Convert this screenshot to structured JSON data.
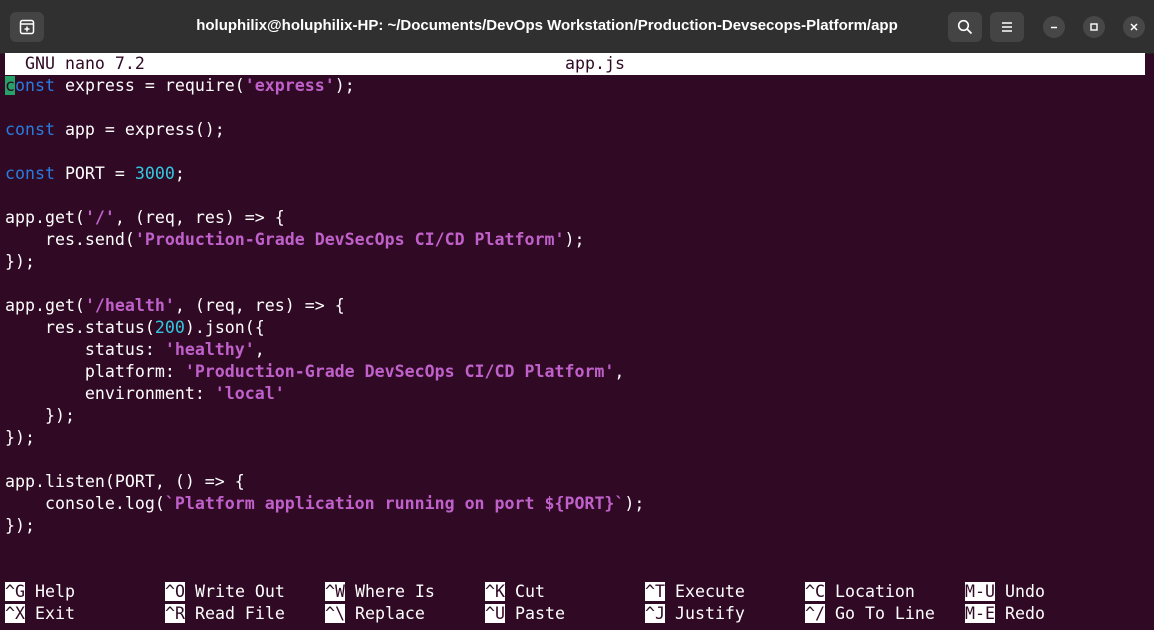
{
  "window": {
    "title": "holuphilix@holuphilix-HP: ~/Documents/DevOps Workstation/Production-Devsecops-Platform/app"
  },
  "nano": {
    "version": "GNU nano 7.2",
    "filename": "app.js"
  },
  "code": {
    "l1_kw": "const",
    "l1_rest_a": " express = require(",
    "l1_str": "'express'",
    "l1_rest_b": ");",
    "l3_kw": "const",
    "l3_rest": " app = express();",
    "l5_kw": "const",
    "l5_rest_a": " PORT = ",
    "l5_num": "3000",
    "l5_rest_b": ";",
    "l7_a": "app.get(",
    "l7_str": "'/'",
    "l7_b": ", (req, res) => {",
    "l8_a": "    res.send(",
    "l8_str": "'Production-Grade DevSecOps CI/CD Platform'",
    "l8_b": ");",
    "l9": "});",
    "l11_a": "app.get(",
    "l11_str": "'/health'",
    "l11_b": ", (req, res) => {",
    "l12_a": "    res.status(",
    "l12_num": "200",
    "l12_b": ").json({",
    "l13_a": "        status: ",
    "l13_str": "'healthy'",
    "l13_b": ",",
    "l14_a": "        platform: ",
    "l14_str": "'Production-Grade DevSecOps CI/CD Platform'",
    "l14_b": ",",
    "l15_a": "        environment: ",
    "l15_str": "'local'",
    "l16": "    });",
    "l17": "});",
    "l19": "app.listen(PORT, () => {",
    "l20_a": "    console.log(",
    "l20_str": "`Platform application running on port ${PORT}`",
    "l20_b": ");",
    "l21": "});"
  },
  "shortcuts": [
    {
      "key": "^G",
      "label": "Help"
    },
    {
      "key": "^O",
      "label": "Write Out"
    },
    {
      "key": "^W",
      "label": "Where Is"
    },
    {
      "key": "^K",
      "label": "Cut"
    },
    {
      "key": "^T",
      "label": "Execute"
    },
    {
      "key": "^C",
      "label": "Location"
    },
    {
      "key": "M-U",
      "label": "Undo"
    },
    {
      "key": "^X",
      "label": "Exit"
    },
    {
      "key": "^R",
      "label": "Read File"
    },
    {
      "key": "^\\",
      "label": "Replace"
    },
    {
      "key": "^U",
      "label": "Paste"
    },
    {
      "key": "^J",
      "label": "Justify"
    },
    {
      "key": "^/",
      "label": "Go To Line"
    },
    {
      "key": "M-E",
      "label": "Redo"
    }
  ],
  "colors": {
    "terminal_bg": "#300a24",
    "keyword": "#2a7bde",
    "string": "#c061cb",
    "number": "#33c7de",
    "cursor": "#26a269"
  }
}
